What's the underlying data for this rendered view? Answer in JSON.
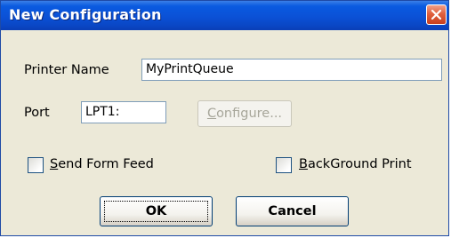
{
  "window": {
    "title": "New Configuration"
  },
  "fields": {
    "printer_name_label": "Printer Name",
    "printer_name_value": "MyPrintQueue",
    "port_label": "Port",
    "port_value": "LPT1:"
  },
  "buttons": {
    "configure": {
      "mnemonic": "C",
      "rest": "onfigure..."
    },
    "ok": "OK",
    "cancel": "Cancel"
  },
  "checkboxes": {
    "send_form_feed": {
      "mnemonic": "S",
      "rest": "end Form Feed",
      "checked": false
    },
    "background_print": {
      "mnemonic": "B",
      "rest": "ackGround Print",
      "checked": false
    }
  },
  "icons": {
    "close": "close-icon"
  },
  "colors": {
    "titlebar": "#0b51d6",
    "dialog_bg": "#ece9d8",
    "close_button": "#e0603e"
  }
}
